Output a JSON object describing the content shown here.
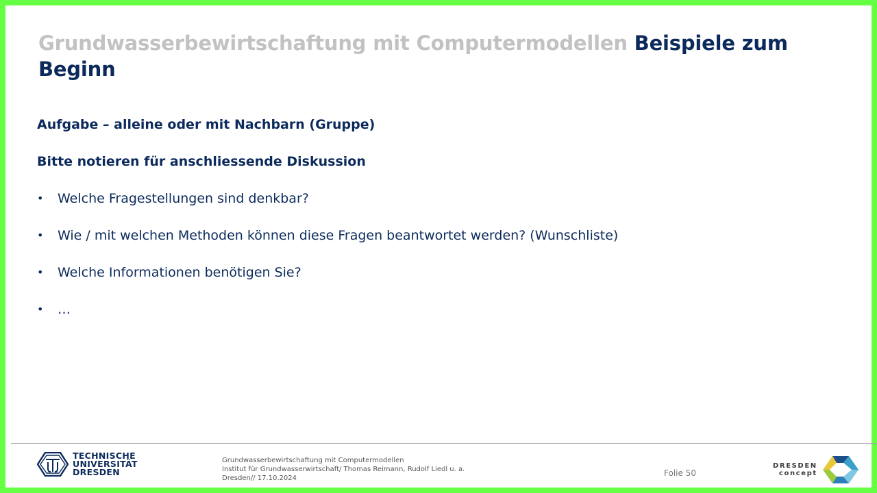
{
  "slide": {
    "title_grey": "Grundwasserbewirtschaftung mit Computermodellen",
    "title_blue": "Beispiele zum Beginn",
    "heading1": "Aufgabe – alleine oder mit Nachbarn (Gruppe)",
    "heading2": "Bitte notieren für anschliessende  Diskussion",
    "bullet_symbol": "•",
    "bullets": [
      "Welche Fragestellungen sind denkbar?",
      "Wie / mit welchen Methoden können diese Fragen beantwortet werden? (Wunschliste)",
      "Welche Informationen benötigen Sie?",
      " …"
    ]
  },
  "footer": {
    "logo_line1": "TECHNISCHE",
    "logo_line2": "UNIVERSITÄT",
    "logo_line3": "DRESDEN",
    "course": "Grundwasserbewirtschaftung mit Computermodellen",
    "institute": "Institut für Grundwasserwirtschaft/ Thomas Reimann, Rudolf Liedl u. a.",
    "place_date": "Dresden// 17.10.2024",
    "slide_number": "Folie 50",
    "partner_line1": "DRESDEN",
    "partner_line2": "concept"
  },
  "colors": {
    "frame": "#66ff44",
    "title_grey": "#c2c2c2",
    "navy": "#0b2a5b"
  }
}
